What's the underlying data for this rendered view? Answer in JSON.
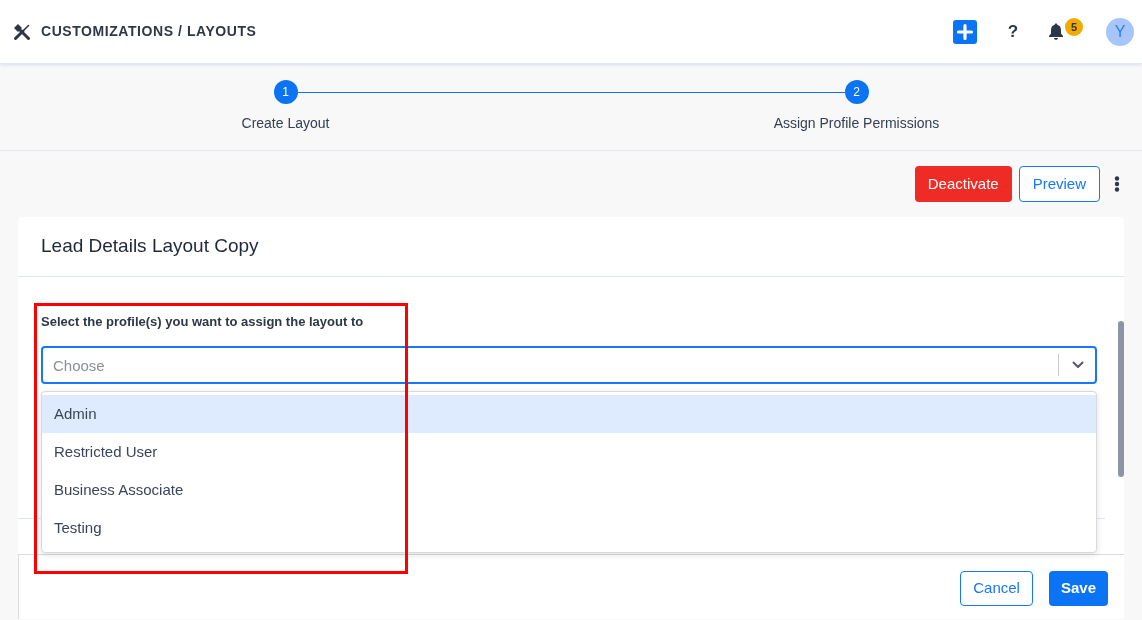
{
  "header": {
    "title": "CUSTOMIZATIONS / LAYOUTS",
    "help": "?",
    "notification_count": "5",
    "avatar_initial": "Y"
  },
  "stepper": {
    "steps": [
      {
        "number": "1",
        "label": "Create Layout"
      },
      {
        "number": "2",
        "label": "Assign Profile Permissions"
      }
    ]
  },
  "actions": [
    {
      "label": "Deactivate",
      "kind": "deactivate"
    },
    {
      "label": "Preview",
      "kind": "preview"
    }
  ],
  "card": {
    "title": "Lead Details Layout Copy",
    "profile_field": {
      "label": "Select the profile(s) you want to assign the layout to",
      "placeholder": "Choose",
      "expanded": true,
      "options": [
        {
          "label": "Admin",
          "selected": true
        },
        {
          "label": "Restricted User",
          "selected": false
        },
        {
          "label": "Business Associate",
          "selected": false
        },
        {
          "label": "Testing",
          "selected": false
        }
      ]
    }
  },
  "footer": {
    "buttons": [
      {
        "label": "Cancel",
        "kind": "cancel"
      },
      {
        "label": "Save",
        "kind": "save"
      }
    ]
  }
}
